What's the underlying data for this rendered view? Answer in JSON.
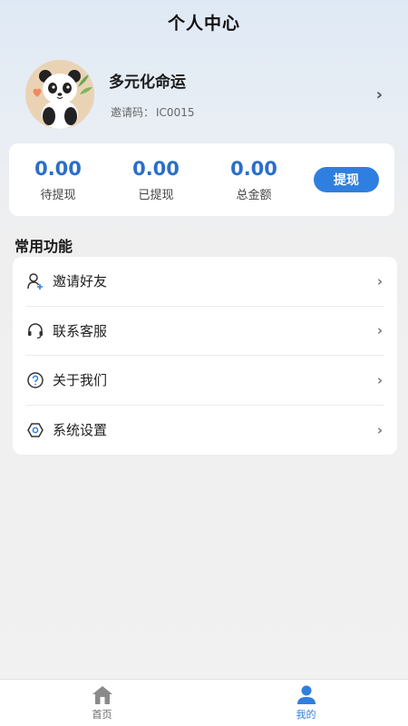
{
  "header": {
    "title": "个人中心"
  },
  "profile": {
    "name": "多元化命运",
    "invite_label": "邀请码：",
    "invite_code": "IC0015"
  },
  "wallet": {
    "items": [
      {
        "amount": "0.00",
        "label": "待提现"
      },
      {
        "amount": "0.00",
        "label": "已提现"
      },
      {
        "amount": "0.00",
        "label": "总金额"
      }
    ],
    "withdraw_label": "提现"
  },
  "features": {
    "title": "常用功能",
    "items": [
      {
        "label": "邀请好友",
        "icon": "user-add-icon"
      },
      {
        "label": "联系客服",
        "icon": "headset-icon"
      },
      {
        "label": "关于我们",
        "icon": "question-icon"
      },
      {
        "label": "系统设置",
        "icon": "settings-icon"
      }
    ]
  },
  "tabbar": {
    "items": [
      {
        "label": "首页",
        "icon": "home-icon"
      },
      {
        "label": "我的",
        "icon": "person-icon",
        "active": true
      }
    ]
  },
  "colors": {
    "accent": "#2f7fe0",
    "amount": "#2b6ec9"
  }
}
